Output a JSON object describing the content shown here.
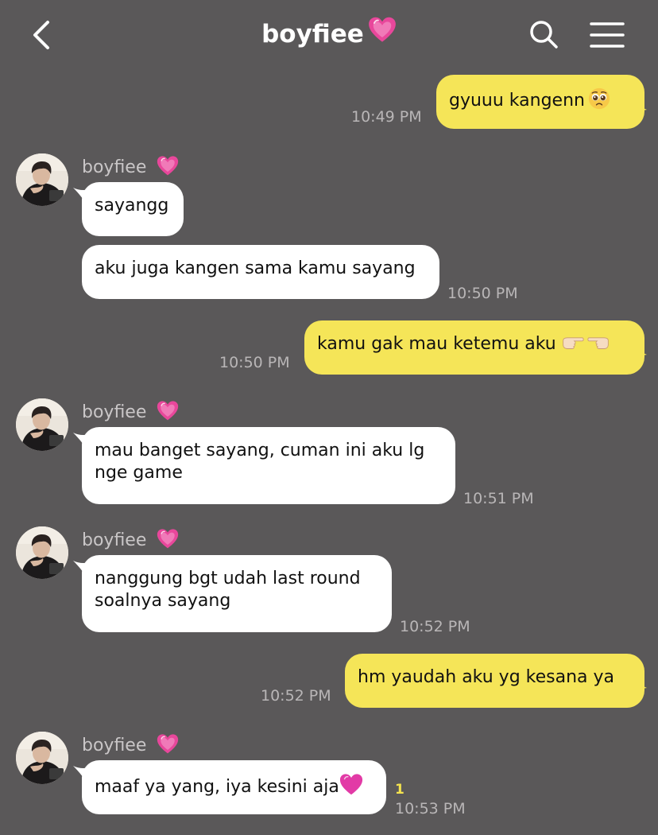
{
  "header": {
    "title": "boyfiee",
    "title_emoji": "sparkling-heart",
    "back_icon": "chevron-left-icon",
    "search_icon": "search-icon",
    "menu_icon": "hamburger-menu-icon"
  },
  "colors": {
    "background": "#5a5859",
    "outgoing_bubble": "#f5e558",
    "incoming_bubble": "#ffffff",
    "timestamp": "#b9b6b7",
    "unread": "#f4e34e",
    "heart": "#e8479b"
  },
  "messages": [
    {
      "direction": "out",
      "text": "gyuuu kangenn",
      "emoji": "pleading-face",
      "time": "10:49 PM"
    },
    {
      "direction": "in",
      "sender": "boyfiee",
      "text": "sayangg"
    },
    {
      "direction": "in",
      "text": "aku juga kangen sama kamu sayang",
      "time": "10:50 PM"
    },
    {
      "direction": "out",
      "text": "kamu gak mau ketemu aku",
      "emoji": "pointing-fingers",
      "time": "10:50 PM"
    },
    {
      "direction": "in",
      "sender": "boyfiee",
      "line1": "mau banget sayang, cuman ini aku lg",
      "line2": "nge game",
      "time": "10:51 PM"
    },
    {
      "direction": "in",
      "sender": "boyfiee",
      "line1": "nanggung bgt udah last round",
      "line2": "soalnya sayang",
      "time": "10:52 PM"
    },
    {
      "direction": "out",
      "text": "hm yaudah aku yg kesana ya",
      "time": "10:52 PM"
    },
    {
      "direction": "in",
      "sender": "boyfiee",
      "text": "maaf ya yang, iya kesini aja",
      "emoji": "purple-heart",
      "unread": "1",
      "time": "10:53 PM"
    }
  ]
}
